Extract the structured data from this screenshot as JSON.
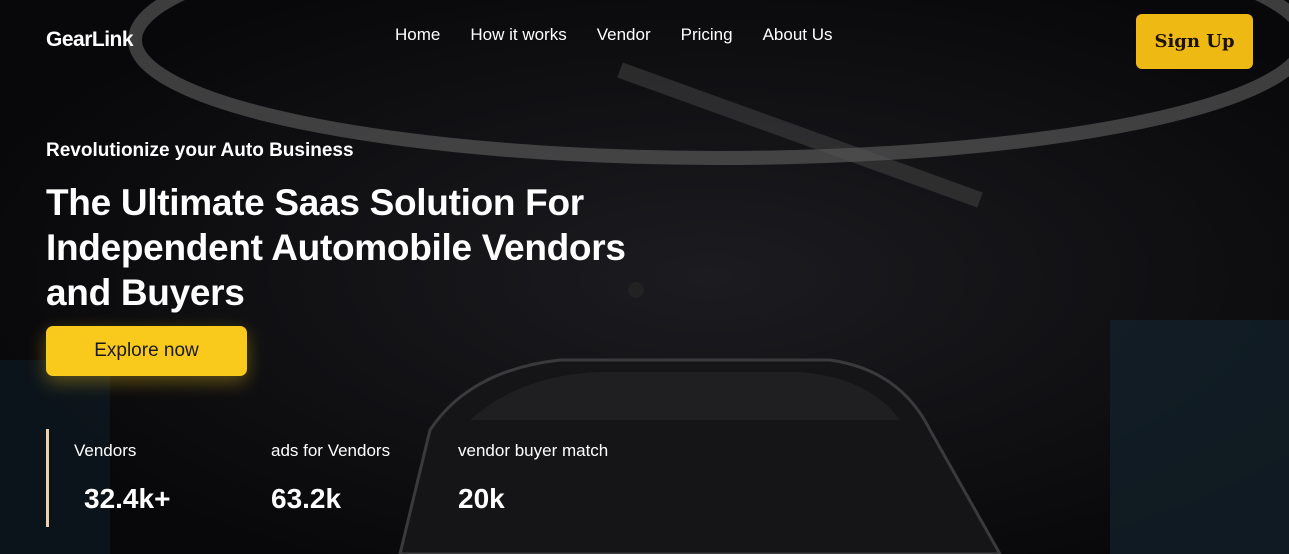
{
  "brand": "GearLink",
  "nav": [
    "Home",
    "How it works",
    "Vendor",
    "Pricing",
    "About Us"
  ],
  "signup": "Sign Up",
  "hero": {
    "eyebrow": "Revolutionize your Auto Business",
    "title": "The Ultimate Saas Solution For Independent Automobile Vendors and Buyers",
    "cta": "Explore now"
  },
  "stats": [
    {
      "label": "Vendors",
      "value": "32.4k+"
    },
    {
      "label": "ads for Vendors",
      "value": "63.2k"
    },
    {
      "label": "vendor buyer match",
      "value": "20k"
    }
  ],
  "colors": {
    "accent": "#f9c91c",
    "signup": "#efb913",
    "background": "#0c0c0e"
  }
}
